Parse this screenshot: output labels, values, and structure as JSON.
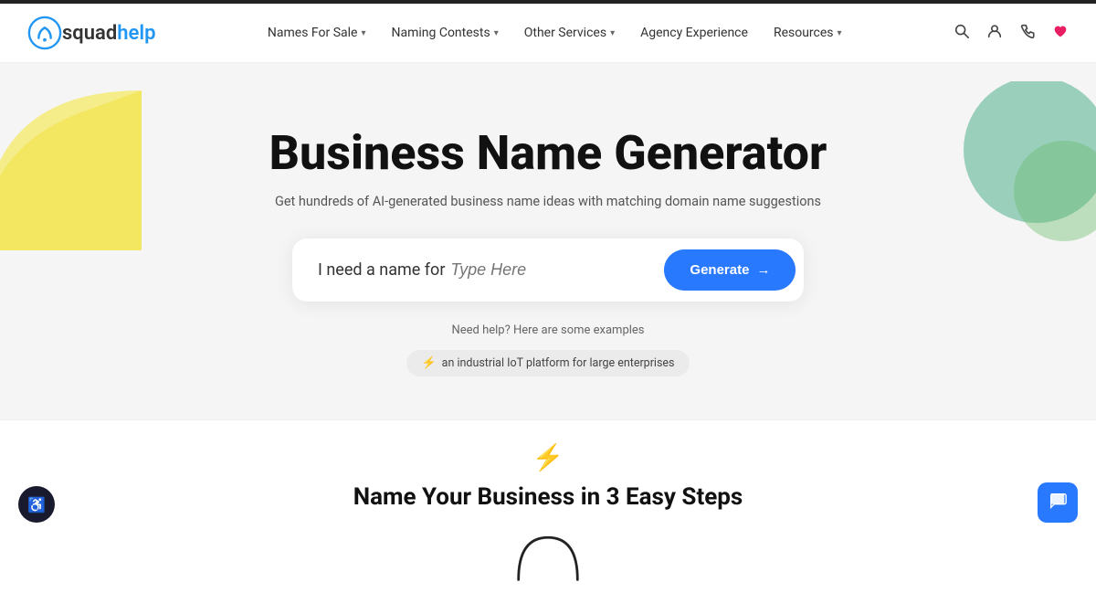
{
  "topbar": {},
  "header": {
    "logo": {
      "text_squad": "squad",
      "text_help": "help"
    },
    "nav": {
      "items": [
        {
          "label": "Names For Sale",
          "hasDropdown": true
        },
        {
          "label": "Naming Contests",
          "hasDropdown": true
        },
        {
          "label": "Other Services",
          "hasDropdown": true
        },
        {
          "label": "Agency Experience",
          "hasDropdown": false
        },
        {
          "label": "Resources",
          "hasDropdown": true
        }
      ]
    },
    "icons": {
      "search": "🔍",
      "user": "👤",
      "phone": "📞",
      "heart": "♥"
    }
  },
  "hero": {
    "title": "Business Name Generator",
    "subtitle": "Get hundreds of AI-generated business name ideas with matching domain name suggestions",
    "search": {
      "prefix": "I need a name for",
      "placeholder": "Type Here"
    },
    "generate_button": "Generate",
    "help_text": "Need help? Here are some examples",
    "example_chip": "an industrial IoT platform for large enterprises"
  },
  "bottom": {
    "section_title": "Name Your Business in 3 Easy Steps"
  },
  "accessibility": {
    "label": "Accessibility"
  },
  "chat": {
    "label": "Chat"
  }
}
